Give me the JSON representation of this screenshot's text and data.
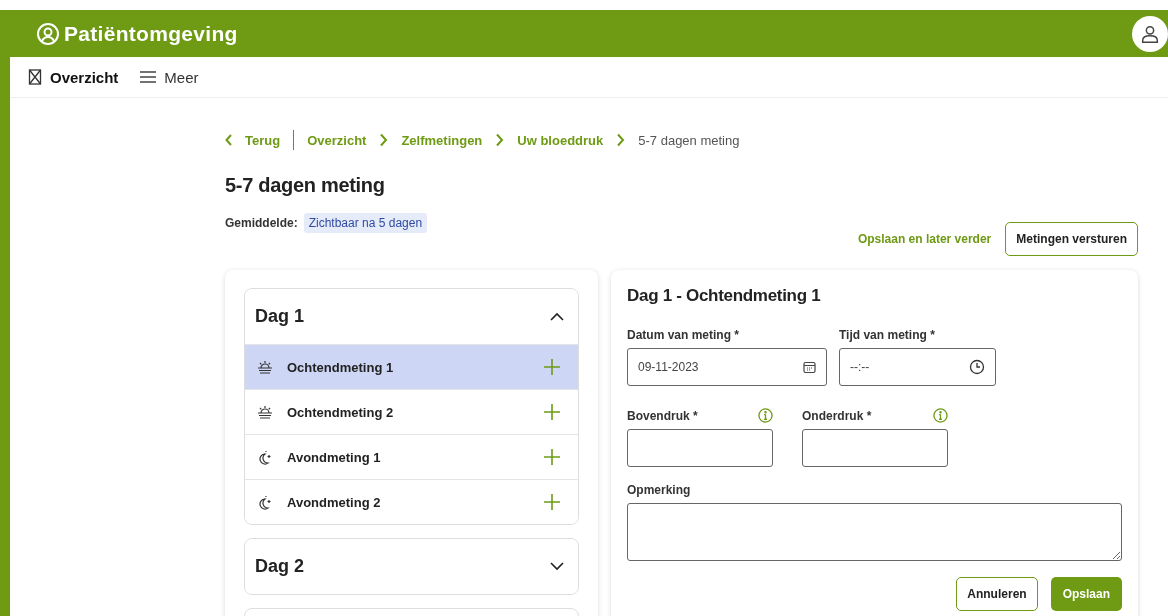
{
  "header": {
    "title": "Patiëntomgeving"
  },
  "nav": [
    {
      "label": "Overzicht",
      "kind": "overview",
      "selected": true
    },
    {
      "label": "Meer",
      "kind": "menu",
      "selected": false
    }
  ],
  "breadcrumb": {
    "back": "Terug",
    "items": [
      "Overzicht",
      "Zelfmetingen",
      "Uw bloeddruk"
    ],
    "current": "5-7 dagen meting"
  },
  "page_title": "5-7 dagen meting",
  "average": {
    "label": "Gemiddelde:",
    "badge": "Zichtbaar na 5 dagen"
  },
  "actions": {
    "save_later": "Opslaan en later verder",
    "send": "Metingen versturen"
  },
  "days": [
    {
      "title": "Dag 1",
      "expanded": true,
      "measurements": [
        {
          "label": "Ochtendmeting 1",
          "kind": "morning",
          "selected": true
        },
        {
          "label": "Ochtendmeting 2",
          "kind": "morning",
          "selected": false
        },
        {
          "label": "Avondmeting 1",
          "kind": "evening",
          "selected": false
        },
        {
          "label": "Avondmeting 2",
          "kind": "evening",
          "selected": false
        }
      ]
    },
    {
      "title": "Dag 2",
      "expanded": false
    },
    {
      "cut_off": true
    }
  ],
  "form": {
    "title": "Dag 1 - Ochtendmeting 1",
    "date": {
      "label": "Datum van meting *",
      "value": "09-11-2023"
    },
    "time": {
      "label": "Tijd van meting *",
      "value": "--:--"
    },
    "systolic": {
      "label": "Bovendruk *"
    },
    "diastolic": {
      "label": "Onderdruk *"
    },
    "remark": {
      "label": "Opmerking"
    },
    "cancel": "Annuleren",
    "save": "Opslaan"
  }
}
